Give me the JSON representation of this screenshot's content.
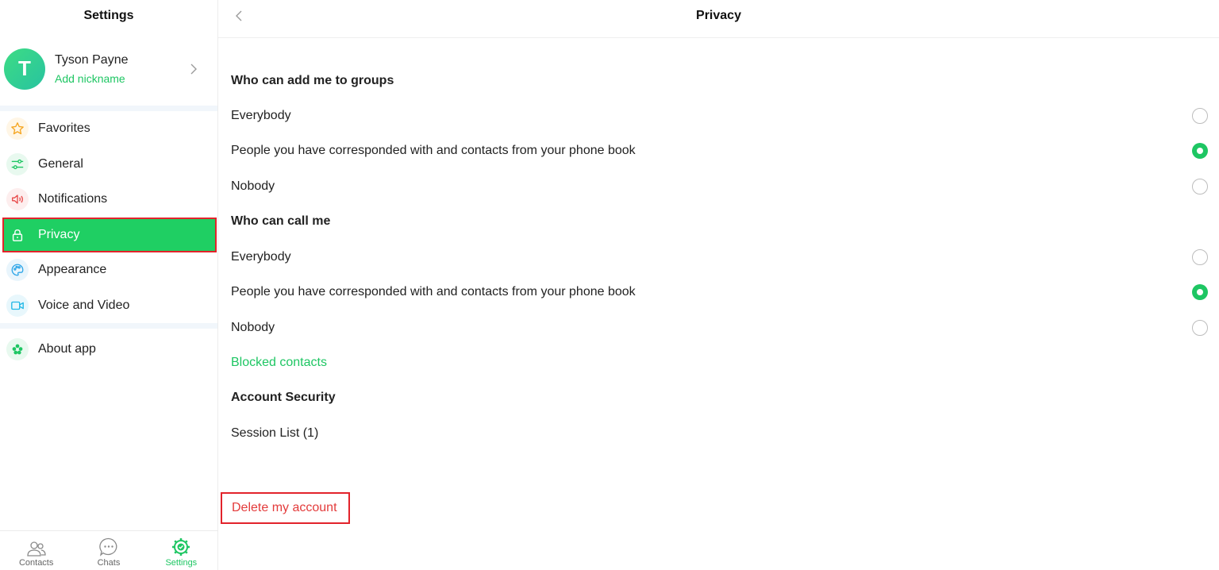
{
  "sidebar": {
    "title": "Settings",
    "profile": {
      "initial": "T",
      "name": "Tyson Payne",
      "nickname_link": "Add nickname"
    },
    "items": [
      {
        "label": "Favorites",
        "icon": "star-icon",
        "color": "#f5a623"
      },
      {
        "label": "General",
        "icon": "sliders-icon",
        "color": "#1ec663"
      },
      {
        "label": "Notifications",
        "icon": "speaker-icon",
        "color": "#e84a4a"
      },
      {
        "label": "Privacy",
        "icon": "lock-icon",
        "color": "#ffffff",
        "active": true
      },
      {
        "label": "Appearance",
        "icon": "palette-icon",
        "color": "#2fa6e8"
      },
      {
        "label": "Voice and Video",
        "icon": "video-camera-icon",
        "color": "#22b8e6"
      }
    ],
    "about": {
      "label": "About app",
      "icon": "clover-icon",
      "color": "#1ec663"
    }
  },
  "tabs": [
    {
      "label": "Contacts",
      "icon": "contacts-icon"
    },
    {
      "label": "Chats",
      "icon": "chat-bubble-icon"
    },
    {
      "label": "Settings",
      "icon": "settings-gear-icon",
      "active": true
    }
  ],
  "header": {
    "title": "Privacy"
  },
  "privacy": {
    "groups_title": "Who can add me to groups",
    "groups_options": [
      {
        "label": "Everybody",
        "selected": false
      },
      {
        "label": "People you have corresponded with and contacts from your phone book",
        "selected": true
      },
      {
        "label": "Nobody",
        "selected": false
      }
    ],
    "call_title": "Who can call me",
    "call_options": [
      {
        "label": "Everybody",
        "selected": false
      },
      {
        "label": "People you have corresponded with and contacts from your phone book",
        "selected": true
      },
      {
        "label": "Nobody",
        "selected": false
      }
    ],
    "blocked_contacts": "Blocked contacts",
    "security_title": "Account Security",
    "session_list": "Session List (1)",
    "delete_account": "Delete my account"
  },
  "colors": {
    "accent": "#1ec663",
    "danger": "#e33b3b",
    "highlight_border": "#e2232b"
  }
}
